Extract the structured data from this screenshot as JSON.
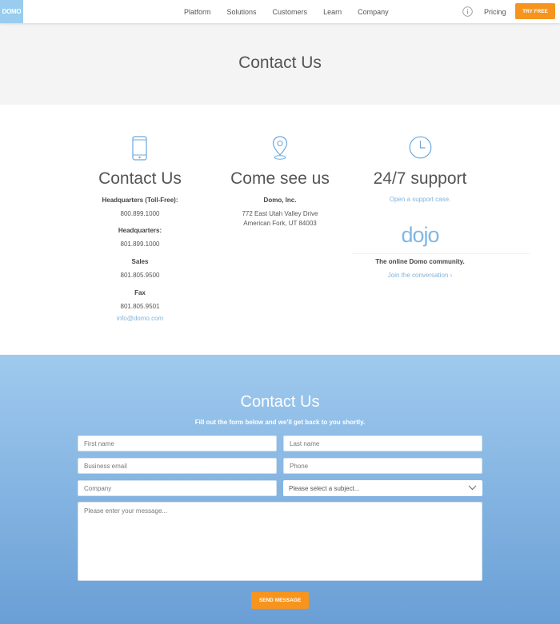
{
  "header": {
    "logo": "DOMO",
    "nav": [
      "Platform",
      "Solutions",
      "Customers",
      "Learn",
      "Company"
    ],
    "pricing": "Pricing",
    "try_free": "TRY FREE"
  },
  "hero": {
    "title": "Contact Us"
  },
  "contact": {
    "title": "Contact Us",
    "hq_tollfree_label": "Headquarters (Toll-Free):",
    "hq_tollfree": "800.899.1000",
    "hq_label": "Headquarters:",
    "hq": "801.899.1000",
    "sales_label": "Sales",
    "sales": "801.805.9500",
    "fax_label": "Fax",
    "fax": "801.805.9501",
    "email": "info@domo.com"
  },
  "visit": {
    "title": "Come see us",
    "company": "Domo, Inc.",
    "address1": "772 East Utah Valley Drive",
    "address2": "American Fork, UT 84003"
  },
  "support": {
    "title": "24/7 support",
    "link": "Open a support case.",
    "dojo_logo": "dojo",
    "community": "The online Domo community.",
    "join": "Join the conversation ›"
  },
  "form": {
    "title": "Contact Us",
    "subtitle": "Fill out the form below and we'll get back to you shortly.",
    "first_name": "First name",
    "last_name": "Last name",
    "email": "Business email",
    "phone": "Phone",
    "company": "Company",
    "subject": "Please select a subject...",
    "message": "Please enter your message...",
    "send": "SEND MESSAGE"
  },
  "colors": {
    "accent": "#f7941d",
    "link": "#7fb4de",
    "icon": "#6aa8dc"
  }
}
